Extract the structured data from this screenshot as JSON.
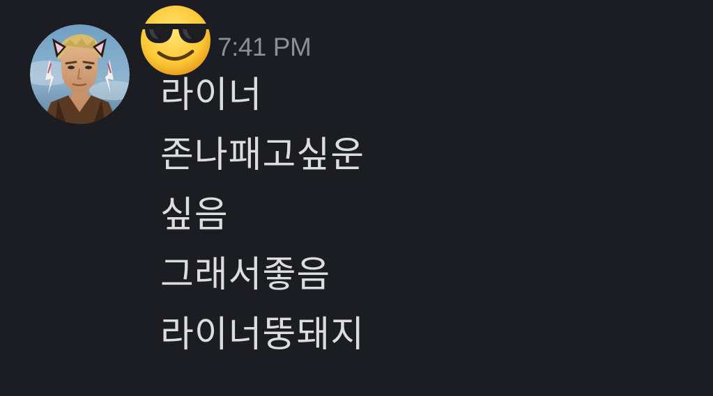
{
  "message": {
    "avatar_icon": "user-avatar-anime-character",
    "username_emoji": "smiling-face-with-sunglasses-icon",
    "timestamp": "7:41 PM",
    "lines": [
      "라이너",
      "존나패고싶운",
      "싶음",
      "그래서좋음",
      "라이너뚱돼지"
    ]
  },
  "colors": {
    "background": "#1c1d23",
    "message_text": "#dcdde1",
    "timestamp_text": "#8d8f96"
  }
}
